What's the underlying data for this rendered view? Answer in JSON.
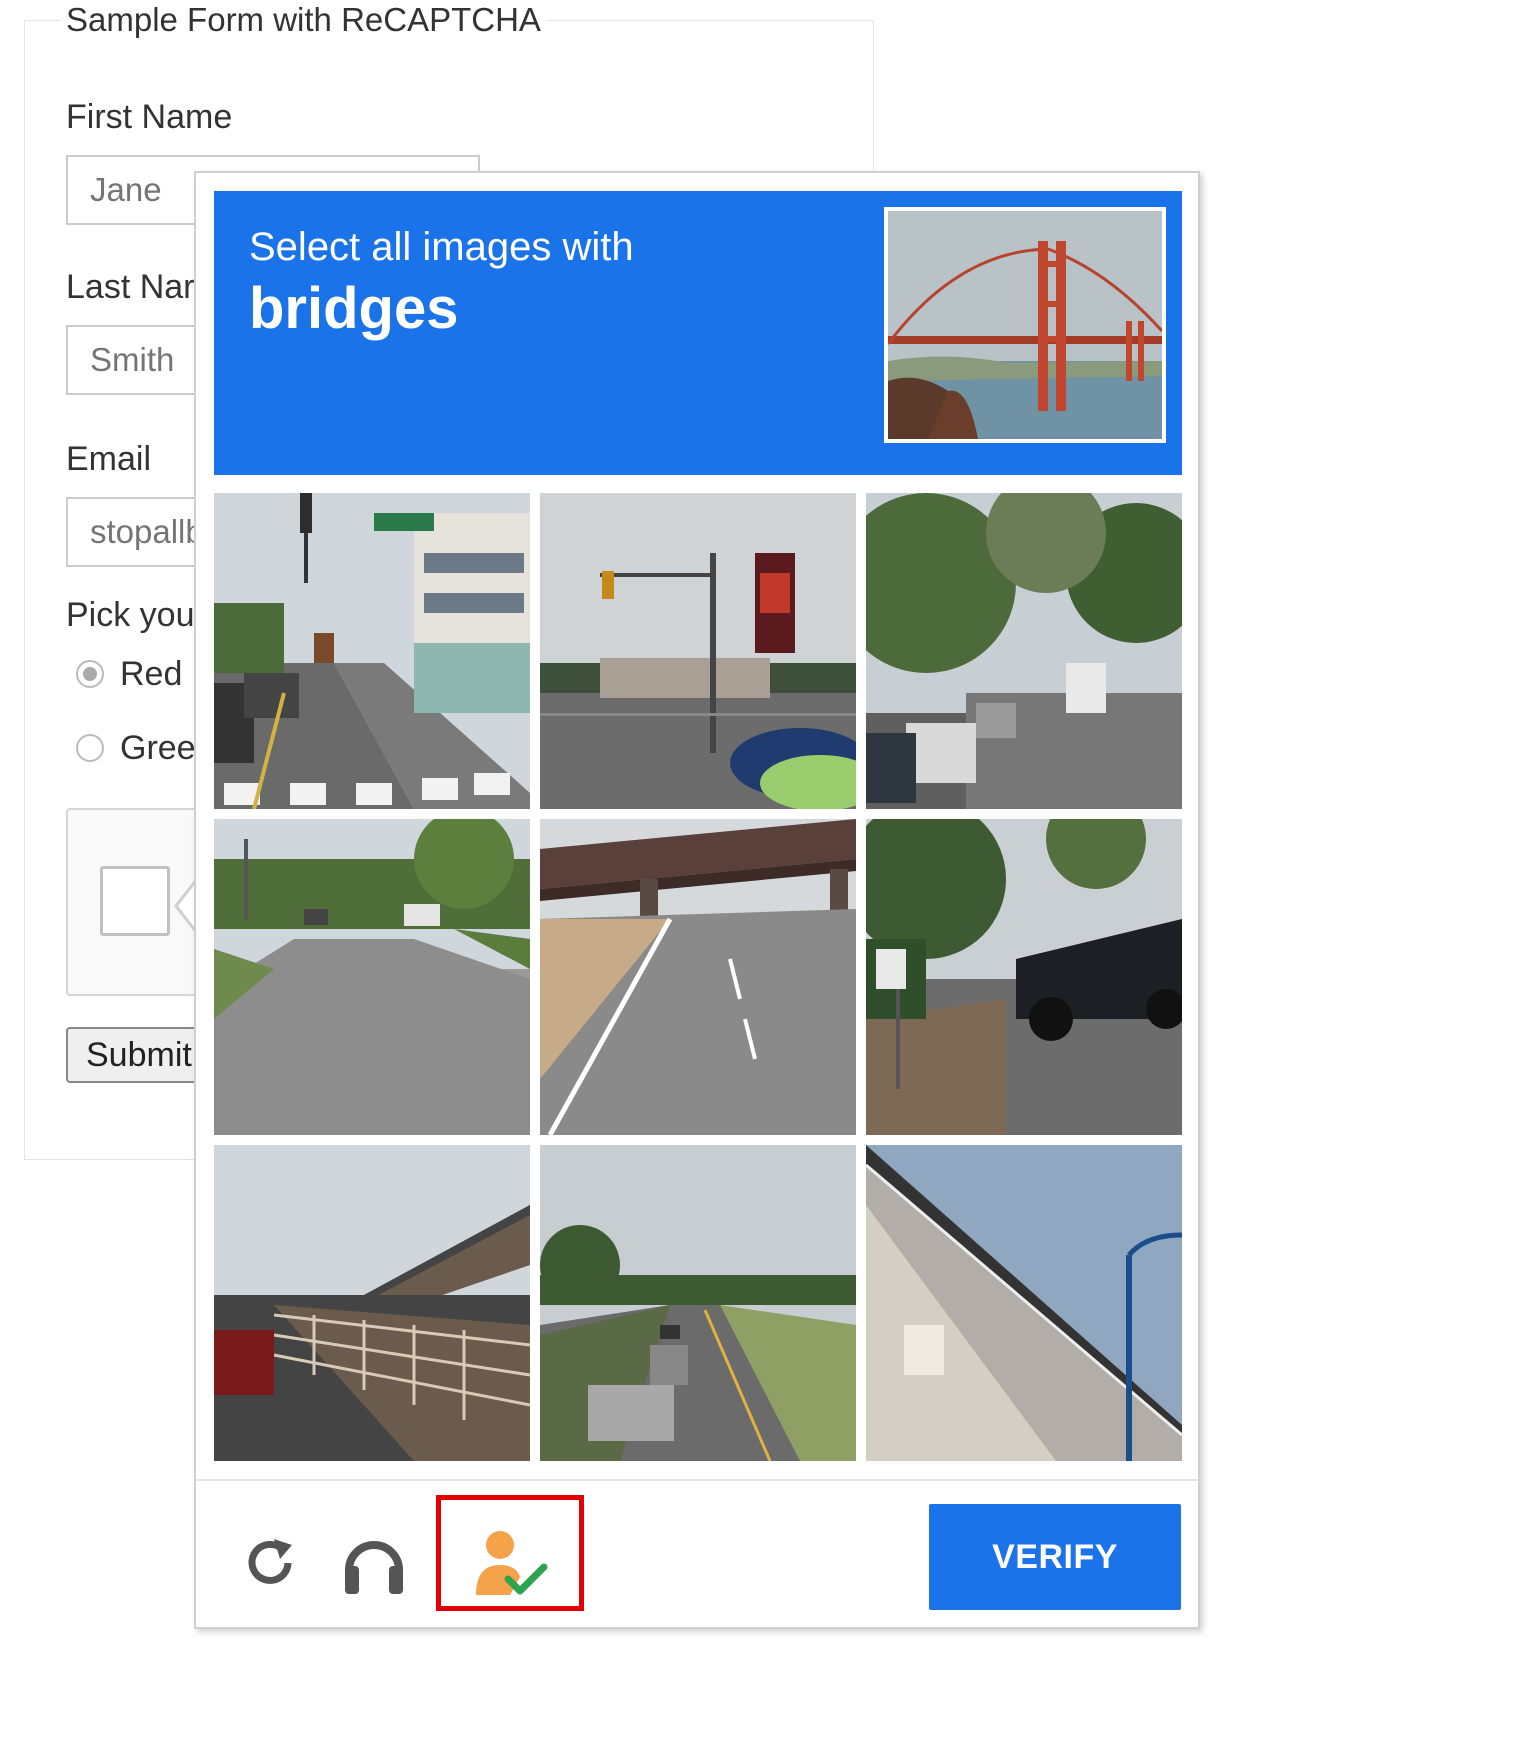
{
  "form": {
    "legend": "Sample Form with ReCAPTCHA",
    "first_name_label": "First Name",
    "first_name_placeholder": "Jane",
    "last_name_label": "Last Nar",
    "last_name_placeholder": "Smith",
    "email_label": "Email",
    "email_placeholder": "stopallb",
    "pick_label": "Pick you",
    "radio_options": [
      "Red",
      "Greer"
    ],
    "selected_option": "Red",
    "submit_label": "Submit"
  },
  "captcha": {
    "prompt": "Select all images with",
    "target": "bridges",
    "sample_image": "golden-gate-bridge",
    "tiles": [
      "street-intersection-traffic-light",
      "street-traffic-light-parked-cars",
      "tree-lined-street-parked-cars",
      "suburban-road",
      "highway-overpass-bridge",
      "sidewalk-parked-car",
      "elevated-bridge-guardrail",
      "highway-cars",
      "bridge-underside-lamp-post"
    ],
    "footer": {
      "reload_icon": "reload-icon",
      "audio_icon": "headphones-icon",
      "extension_icon": "person-check-icon",
      "verify_label": "VERIFY"
    },
    "colors": {
      "header": "#1a73e8",
      "verify": "#1a73e8",
      "highlight": "#e00000",
      "person": "#f5a24b",
      "check": "#2ea44f"
    }
  }
}
